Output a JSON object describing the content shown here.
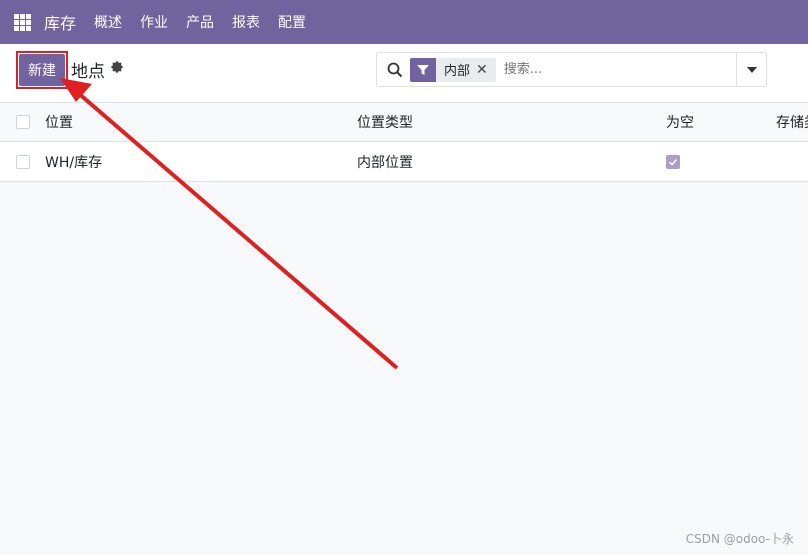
{
  "topbar": {
    "app_name": "库存",
    "menu": [
      "概述",
      "作业",
      "产品",
      "报表",
      "配置"
    ]
  },
  "control": {
    "new_button": "新建",
    "page_title": "地点",
    "search": {
      "facet_label": "内部",
      "placeholder": "搜索..."
    }
  },
  "table": {
    "headers": [
      "位置",
      "位置类型",
      "为空",
      "存储类"
    ],
    "rows": [
      {
        "location": "WH/库存",
        "type": "内部位置",
        "empty": true
      }
    ]
  },
  "watermark": "CSDN @odoo-卜永",
  "colors": {
    "brand": "#71639e",
    "annotation": "#e02020"
  }
}
